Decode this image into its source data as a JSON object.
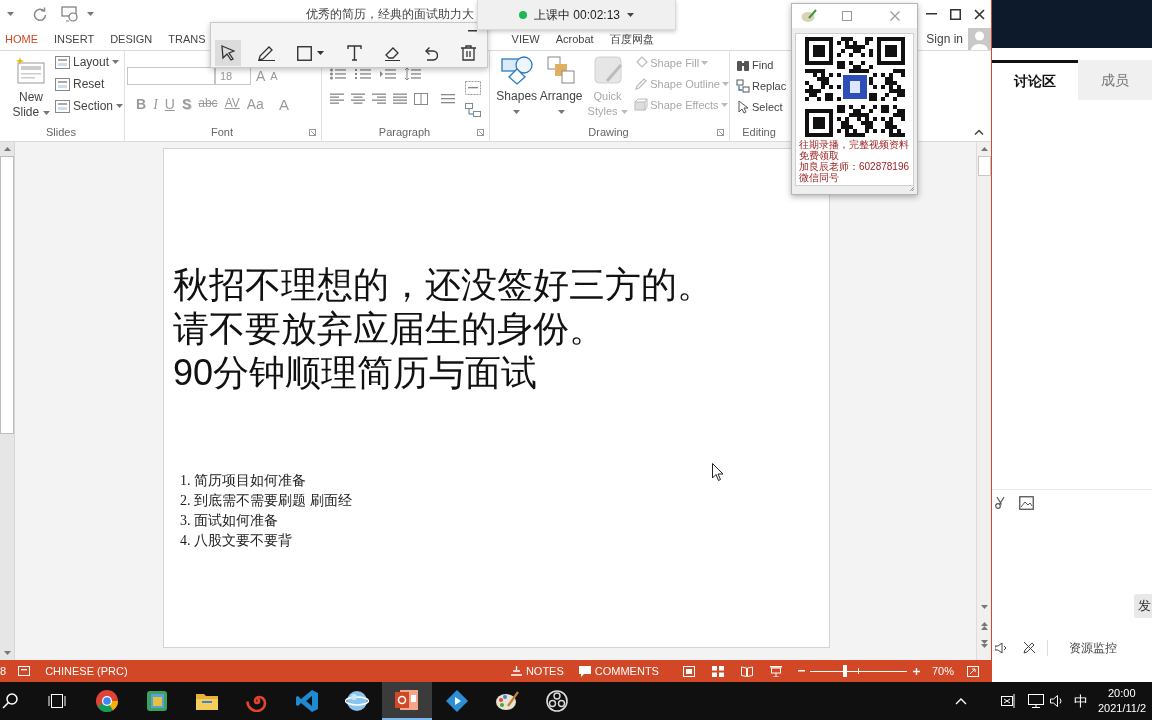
{
  "title_bar": {
    "title": "优秀的简历，经典的面试助力大"
  },
  "ribbon_tabs": [
    {
      "label": "HOME",
      "selected": true
    },
    {
      "label": "INSERT",
      "selected": false
    },
    {
      "label": "DESIGN",
      "selected": false
    },
    {
      "label": "TRANS",
      "selected": false
    },
    {
      "label": "VIEW",
      "selected": false
    },
    {
      "label": "Acrobat",
      "selected": false
    },
    {
      "label": "百度网盘",
      "selected": false
    }
  ],
  "account": {
    "label": "Sign in"
  },
  "ribbon": {
    "slides": {
      "label": "Slides",
      "new_slide": "New Slide",
      "buttons": [
        "Layout",
        "Reset",
        "Section"
      ]
    },
    "font": {
      "label": "Font",
      "size": "18",
      "size_buttons": [
        "A",
        "A"
      ],
      "format_buttons": [
        {
          "kind": "bold",
          "label": "B",
          "disabled": true
        },
        {
          "kind": "italic",
          "label": "I",
          "disabled": true
        },
        {
          "kind": "underline",
          "label": "U",
          "disabled": true
        },
        {
          "kind": "shadow",
          "label": "S",
          "disabled": true
        },
        {
          "kind": "strike",
          "label": "abc",
          "disabled": true
        },
        {
          "kind": "spacing",
          "label": "AV",
          "disabled": true
        },
        {
          "kind": "case",
          "label": "Aa",
          "disabled": true
        },
        {
          "kind": "color",
          "label": "A",
          "disabled": true
        }
      ]
    },
    "paragraph": {
      "label": "Paragraph"
    },
    "drawing": {
      "label": "Drawing",
      "large_buttons": [
        {
          "kind": "shapes",
          "label": "Shapes",
          "disabled": false
        },
        {
          "kind": "arrange",
          "label": "Arrange",
          "disabled": false
        },
        {
          "kind": "styles",
          "label": "Quick Styles",
          "disabled": true
        }
      ],
      "style_buttons": [
        {
          "kind": "fill",
          "label": "Shape Fill",
          "disabled": true
        },
        {
          "kind": "outline",
          "label": "Shape Outline",
          "disabled": true
        },
        {
          "kind": "effects",
          "label": "Shape Effects",
          "disabled": true
        }
      ]
    },
    "editing": {
      "label": "Editing",
      "buttons": [
        {
          "kind": "find",
          "label": "Find"
        },
        {
          "kind": "replace",
          "label": "Replac"
        },
        {
          "kind": "select",
          "label": "Select"
        }
      ]
    }
  },
  "slide": {
    "title_lines": [
      "秋招不理想的，还没签好三方的。",
      "请不要放弃应届生的身份。",
      "90分钟顺理简历与面试"
    ],
    "list_items": [
      "1. 简历项目如何准备",
      "2. 到底需不需要刷题 刷面经",
      "3. 面试如何准备",
      "4. 八股文要不要背"
    ]
  },
  "status_bar": {
    "slide_count": "8",
    "language": "CHINESE (PRC)",
    "notes": "NOTES",
    "comments": "COMMENTS",
    "zoom": {
      "level": 0.36,
      "reading": "70%"
    }
  },
  "class_timer": {
    "text": "上课中 00:02:13"
  },
  "annotation_toolbar": {
    "tools": [
      {
        "kind": "pointer",
        "selected": true
      },
      {
        "kind": "pen",
        "selected": false
      },
      {
        "kind": "rectangle",
        "selected": false
      },
      {
        "kind": "text",
        "selected": false
      },
      {
        "kind": "eraser",
        "selected": false
      },
      {
        "kind": "undo",
        "selected": false
      },
      {
        "kind": "delete",
        "selected": false
      }
    ]
  },
  "qr_window": {
    "caption_lines": [
      "往期录播，完整视频资料免费领取",
      "加良辰老师：602878196 微信同号"
    ]
  },
  "side_panel": {
    "tabs": [
      {
        "label": "讨论区",
        "selected": true
      },
      {
        "label": "成员",
        "selected": false
      }
    ],
    "send_button": "发",
    "monitor_label": "资源监控"
  },
  "taskbar": {
    "apps": [
      {
        "kind": "browser",
        "selected": false
      },
      {
        "kind": "tiles",
        "selected": false
      },
      {
        "kind": "folder",
        "selected": false
      },
      {
        "kind": "spiral",
        "selected": false
      },
      {
        "kind": "code",
        "selected": false
      },
      {
        "kind": "globe",
        "selected": false
      },
      {
        "kind": "slides",
        "selected": true
      },
      {
        "kind": "play",
        "selected": false
      },
      {
        "kind": "palette",
        "selected": false
      },
      {
        "kind": "record",
        "selected": false
      }
    ],
    "ime": "中",
    "time": "20:00",
    "date": "2021/11/2"
  }
}
